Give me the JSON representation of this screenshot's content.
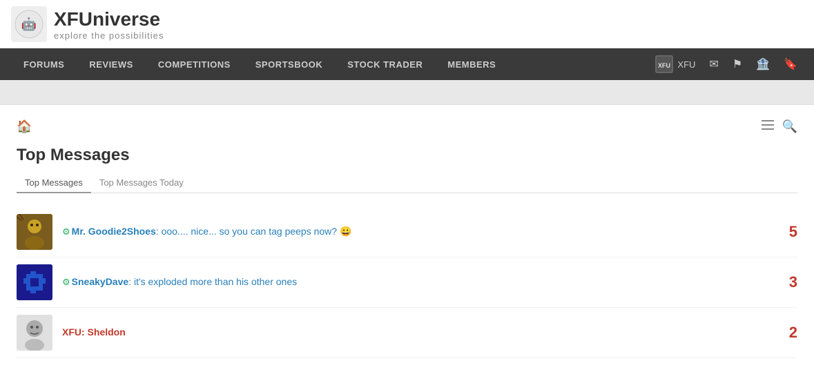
{
  "site": {
    "name": "XFUniverse",
    "tagline": "explore the possibilities"
  },
  "nav": {
    "items": [
      {
        "label": "FORUMS",
        "name": "forums"
      },
      {
        "label": "REVIEWS",
        "name": "reviews"
      },
      {
        "label": "COMPETITIONS",
        "name": "competitions"
      },
      {
        "label": "SPORTSBOOK",
        "name": "sportsbook"
      },
      {
        "label": "STOCK TRADER",
        "name": "stock-trader"
      },
      {
        "label": "MEMBERS",
        "name": "members"
      }
    ],
    "user": {
      "label": "XFU",
      "avatar_text": "XFU"
    }
  },
  "page": {
    "title": "Top Messages",
    "tabs": [
      {
        "label": "Top Messages",
        "active": true
      },
      {
        "label": "Top Messages Today",
        "active": false
      }
    ]
  },
  "messages": [
    {
      "username": "Mr. Goodie2Shoes",
      "username_class": "gear",
      "text": ": ooo.... nice... so you can tag peeps now? 😀",
      "count": "5",
      "avatar_type": "1"
    },
    {
      "username": "SneakyDave",
      "username_class": "gear",
      "text": ": it's exploded more than his other ones",
      "count": "3",
      "avatar_type": "2"
    },
    {
      "username": "XFU: Sheldon",
      "username_class": "xfu",
      "text": "",
      "count": "2",
      "avatar_type": "3"
    }
  ]
}
